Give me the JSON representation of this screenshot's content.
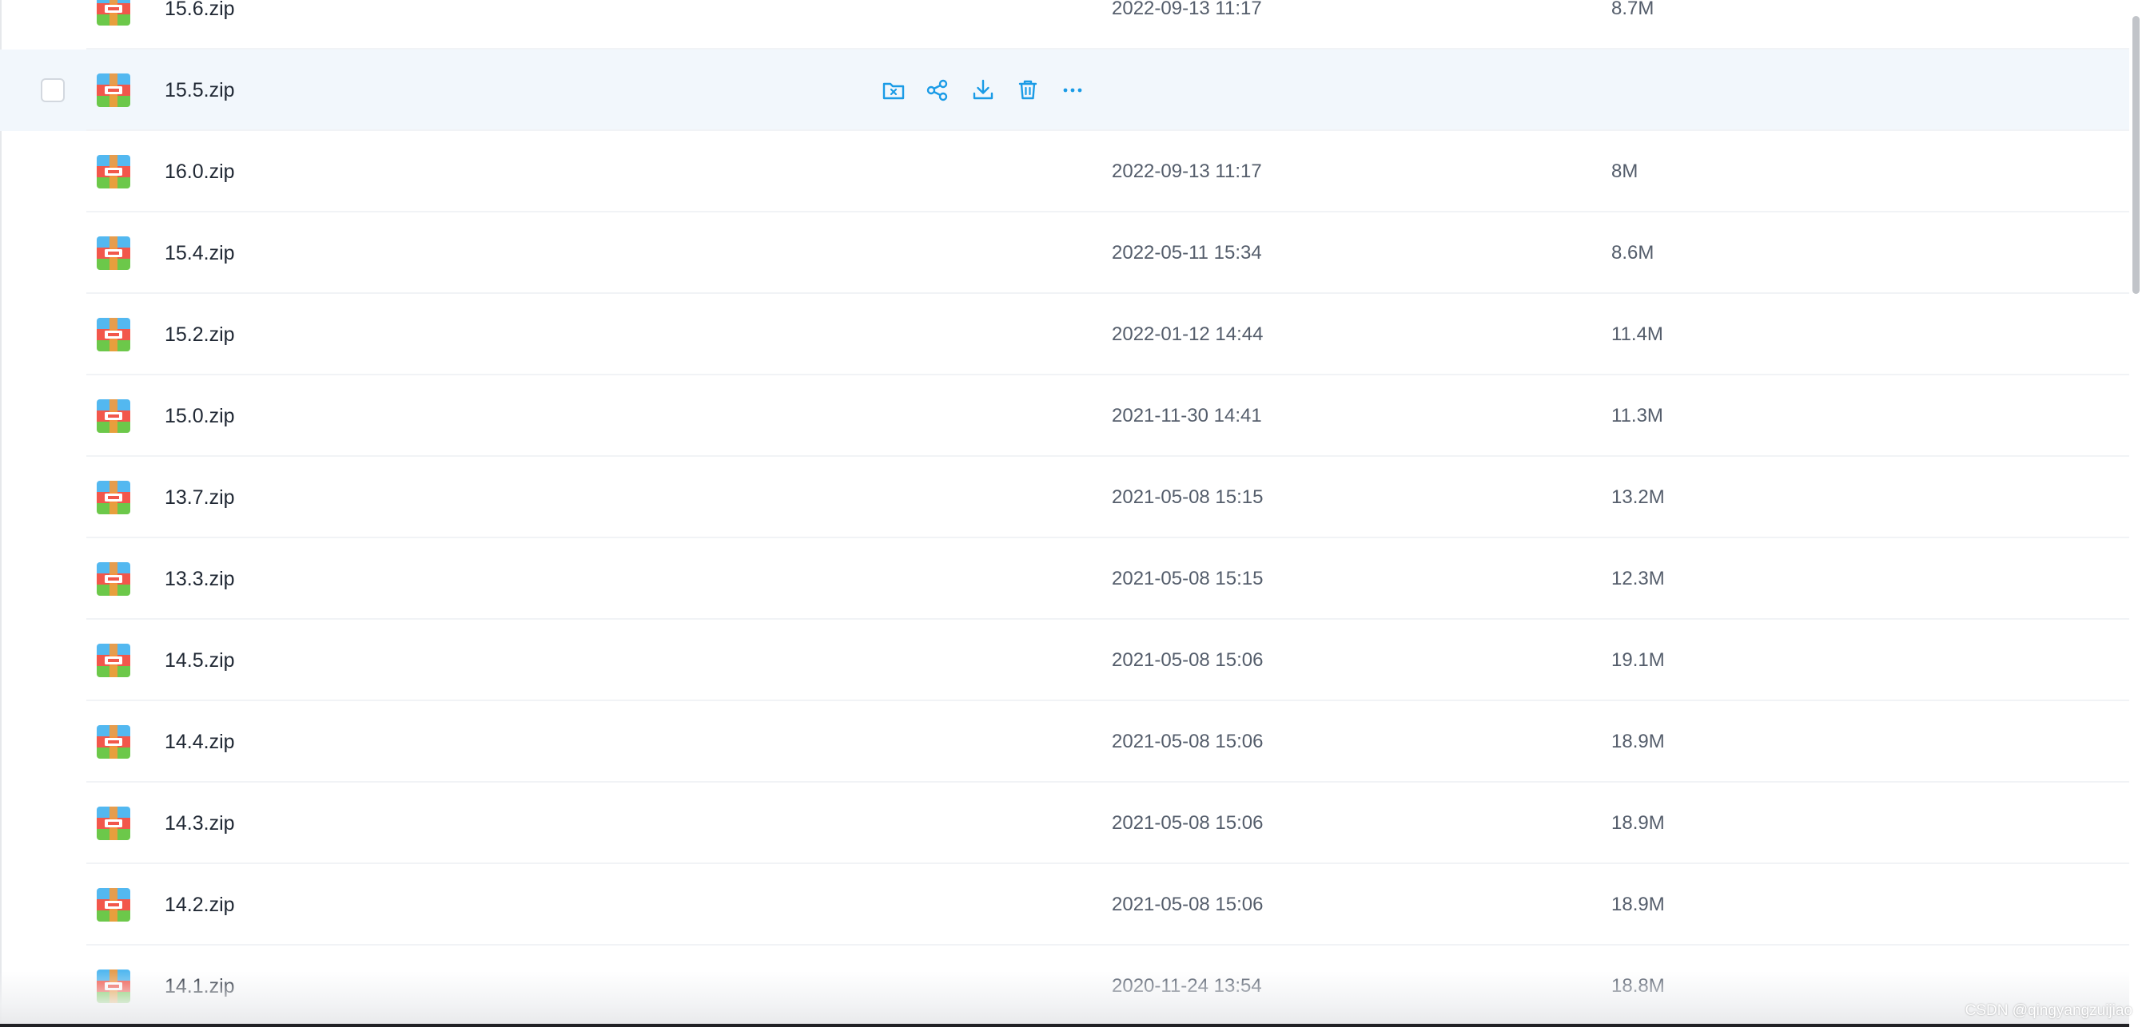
{
  "colors": {
    "accent": "#1a9be6",
    "hover_row_bg": "#f2f7fc",
    "name_text": "#1f2733",
    "meta_text": "#545d6b"
  },
  "icons": {
    "file_type": "zip-archive-icon",
    "actions": [
      "move-to-folder-icon",
      "share-icon",
      "download-icon",
      "delete-icon",
      "more-icon"
    ]
  },
  "files": [
    {
      "name": "15.6.zip",
      "date": "2022-09-13 11:17",
      "size": "8.7M"
    },
    {
      "name": "15.5.zip",
      "date": "",
      "size": ""
    },
    {
      "name": "16.0.zip",
      "date": "2022-09-13 11:17",
      "size": "8M"
    },
    {
      "name": "15.4.zip",
      "date": "2022-05-11 15:34",
      "size": "8.6M"
    },
    {
      "name": "15.2.zip",
      "date": "2022-01-12 14:44",
      "size": "11.4M"
    },
    {
      "name": "15.0.zip",
      "date": "2021-11-30 14:41",
      "size": "11.3M"
    },
    {
      "name": "13.7.zip",
      "date": "2021-05-08 15:15",
      "size": "13.2M"
    },
    {
      "name": "13.3.zip",
      "date": "2021-05-08 15:15",
      "size": "12.3M"
    },
    {
      "name": "14.5.zip",
      "date": "2021-05-08 15:06",
      "size": "19.1M"
    },
    {
      "name": "14.4.zip",
      "date": "2021-05-08 15:06",
      "size": "18.9M"
    },
    {
      "name": "14.3.zip",
      "date": "2021-05-08 15:06",
      "size": "18.9M"
    },
    {
      "name": "14.2.zip",
      "date": "2021-05-08 15:06",
      "size": "18.9M"
    },
    {
      "name": "14.1.zip",
      "date": "2020-11-24 13:54",
      "size": "18.8M"
    }
  ],
  "hovered_row_index": 1,
  "watermark": "CSDN @qingyangzuijiao"
}
